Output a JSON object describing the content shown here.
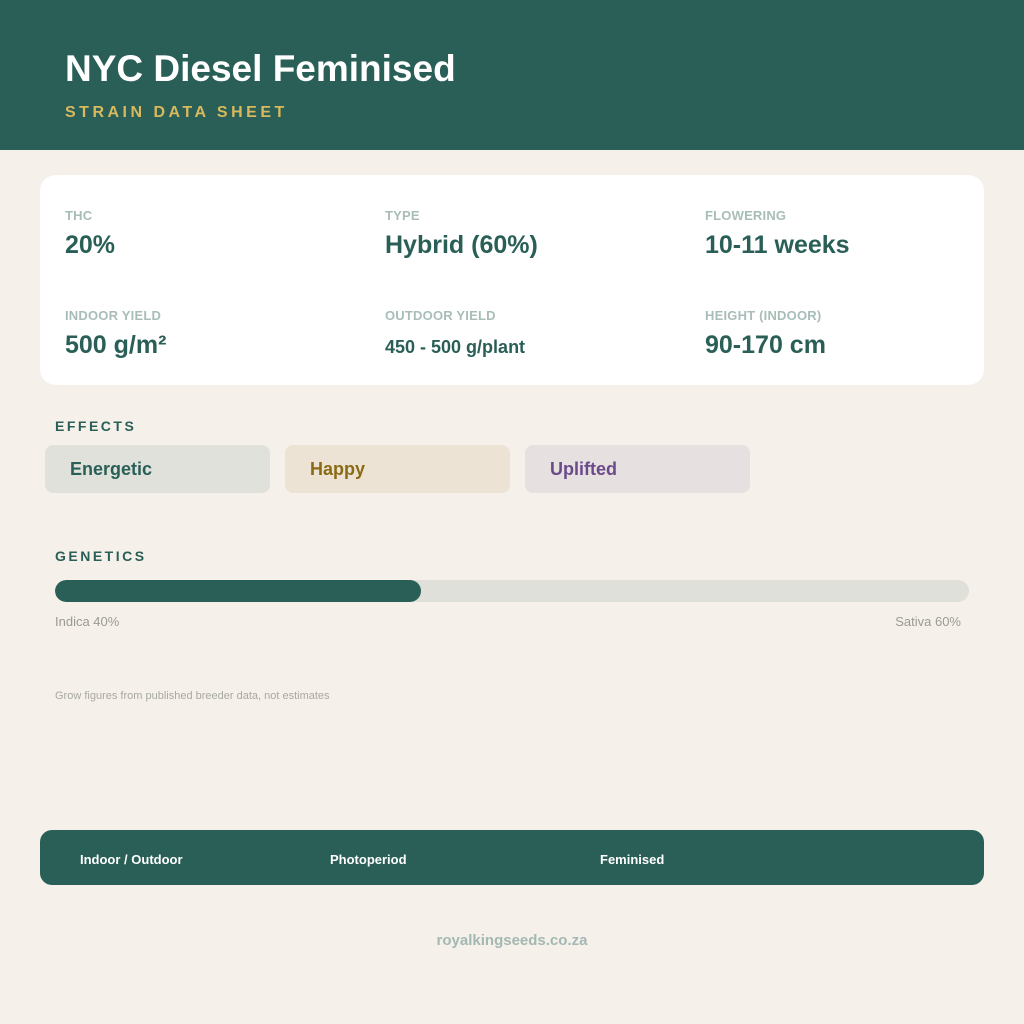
{
  "header": {
    "title": "NYC Diesel Feminised",
    "subtitle": "STRAIN DATA SHEET"
  },
  "stats": [
    {
      "label": "THC",
      "value": "20%"
    },
    {
      "label": "TYPE",
      "value": "Hybrid (60%)"
    },
    {
      "label": "FLOWERING",
      "value": "10-11 weeks"
    },
    {
      "label": "INDOOR YIELD",
      "value": "500 g/m²"
    },
    {
      "label": "OUTDOOR YIELD",
      "value": "450 - 500 g/plant"
    },
    {
      "label": "HEIGHT (INDOOR)",
      "value": "90-170 cm"
    }
  ],
  "effects": {
    "heading": "EFFECTS",
    "items": [
      {
        "label": "Energetic",
        "color": "#295f57",
        "bg": "#e0e1db"
      },
      {
        "label": "Happy",
        "color": "#8a6a14",
        "bg": "#ede3d4"
      },
      {
        "label": "Uplifted",
        "color": "#6b4a8a",
        "bg": "#e6e0e0"
      }
    ]
  },
  "genetics": {
    "heading": "GENETICS",
    "indica_percent": 40,
    "sativa_percent": 60,
    "indica_label": "Indica 40%",
    "sativa_label": "Sativa 60%"
  },
  "note": "Grow figures from published breeder data, not estimates",
  "footer": {
    "items": [
      "Indoor / Outdoor",
      "Photoperiod",
      "Feminised"
    ]
  },
  "website": "royalkingseeds.co.za",
  "colors": {
    "primary": "#295f57",
    "accent": "#d9b95d",
    "background": "#f5f0ea"
  }
}
